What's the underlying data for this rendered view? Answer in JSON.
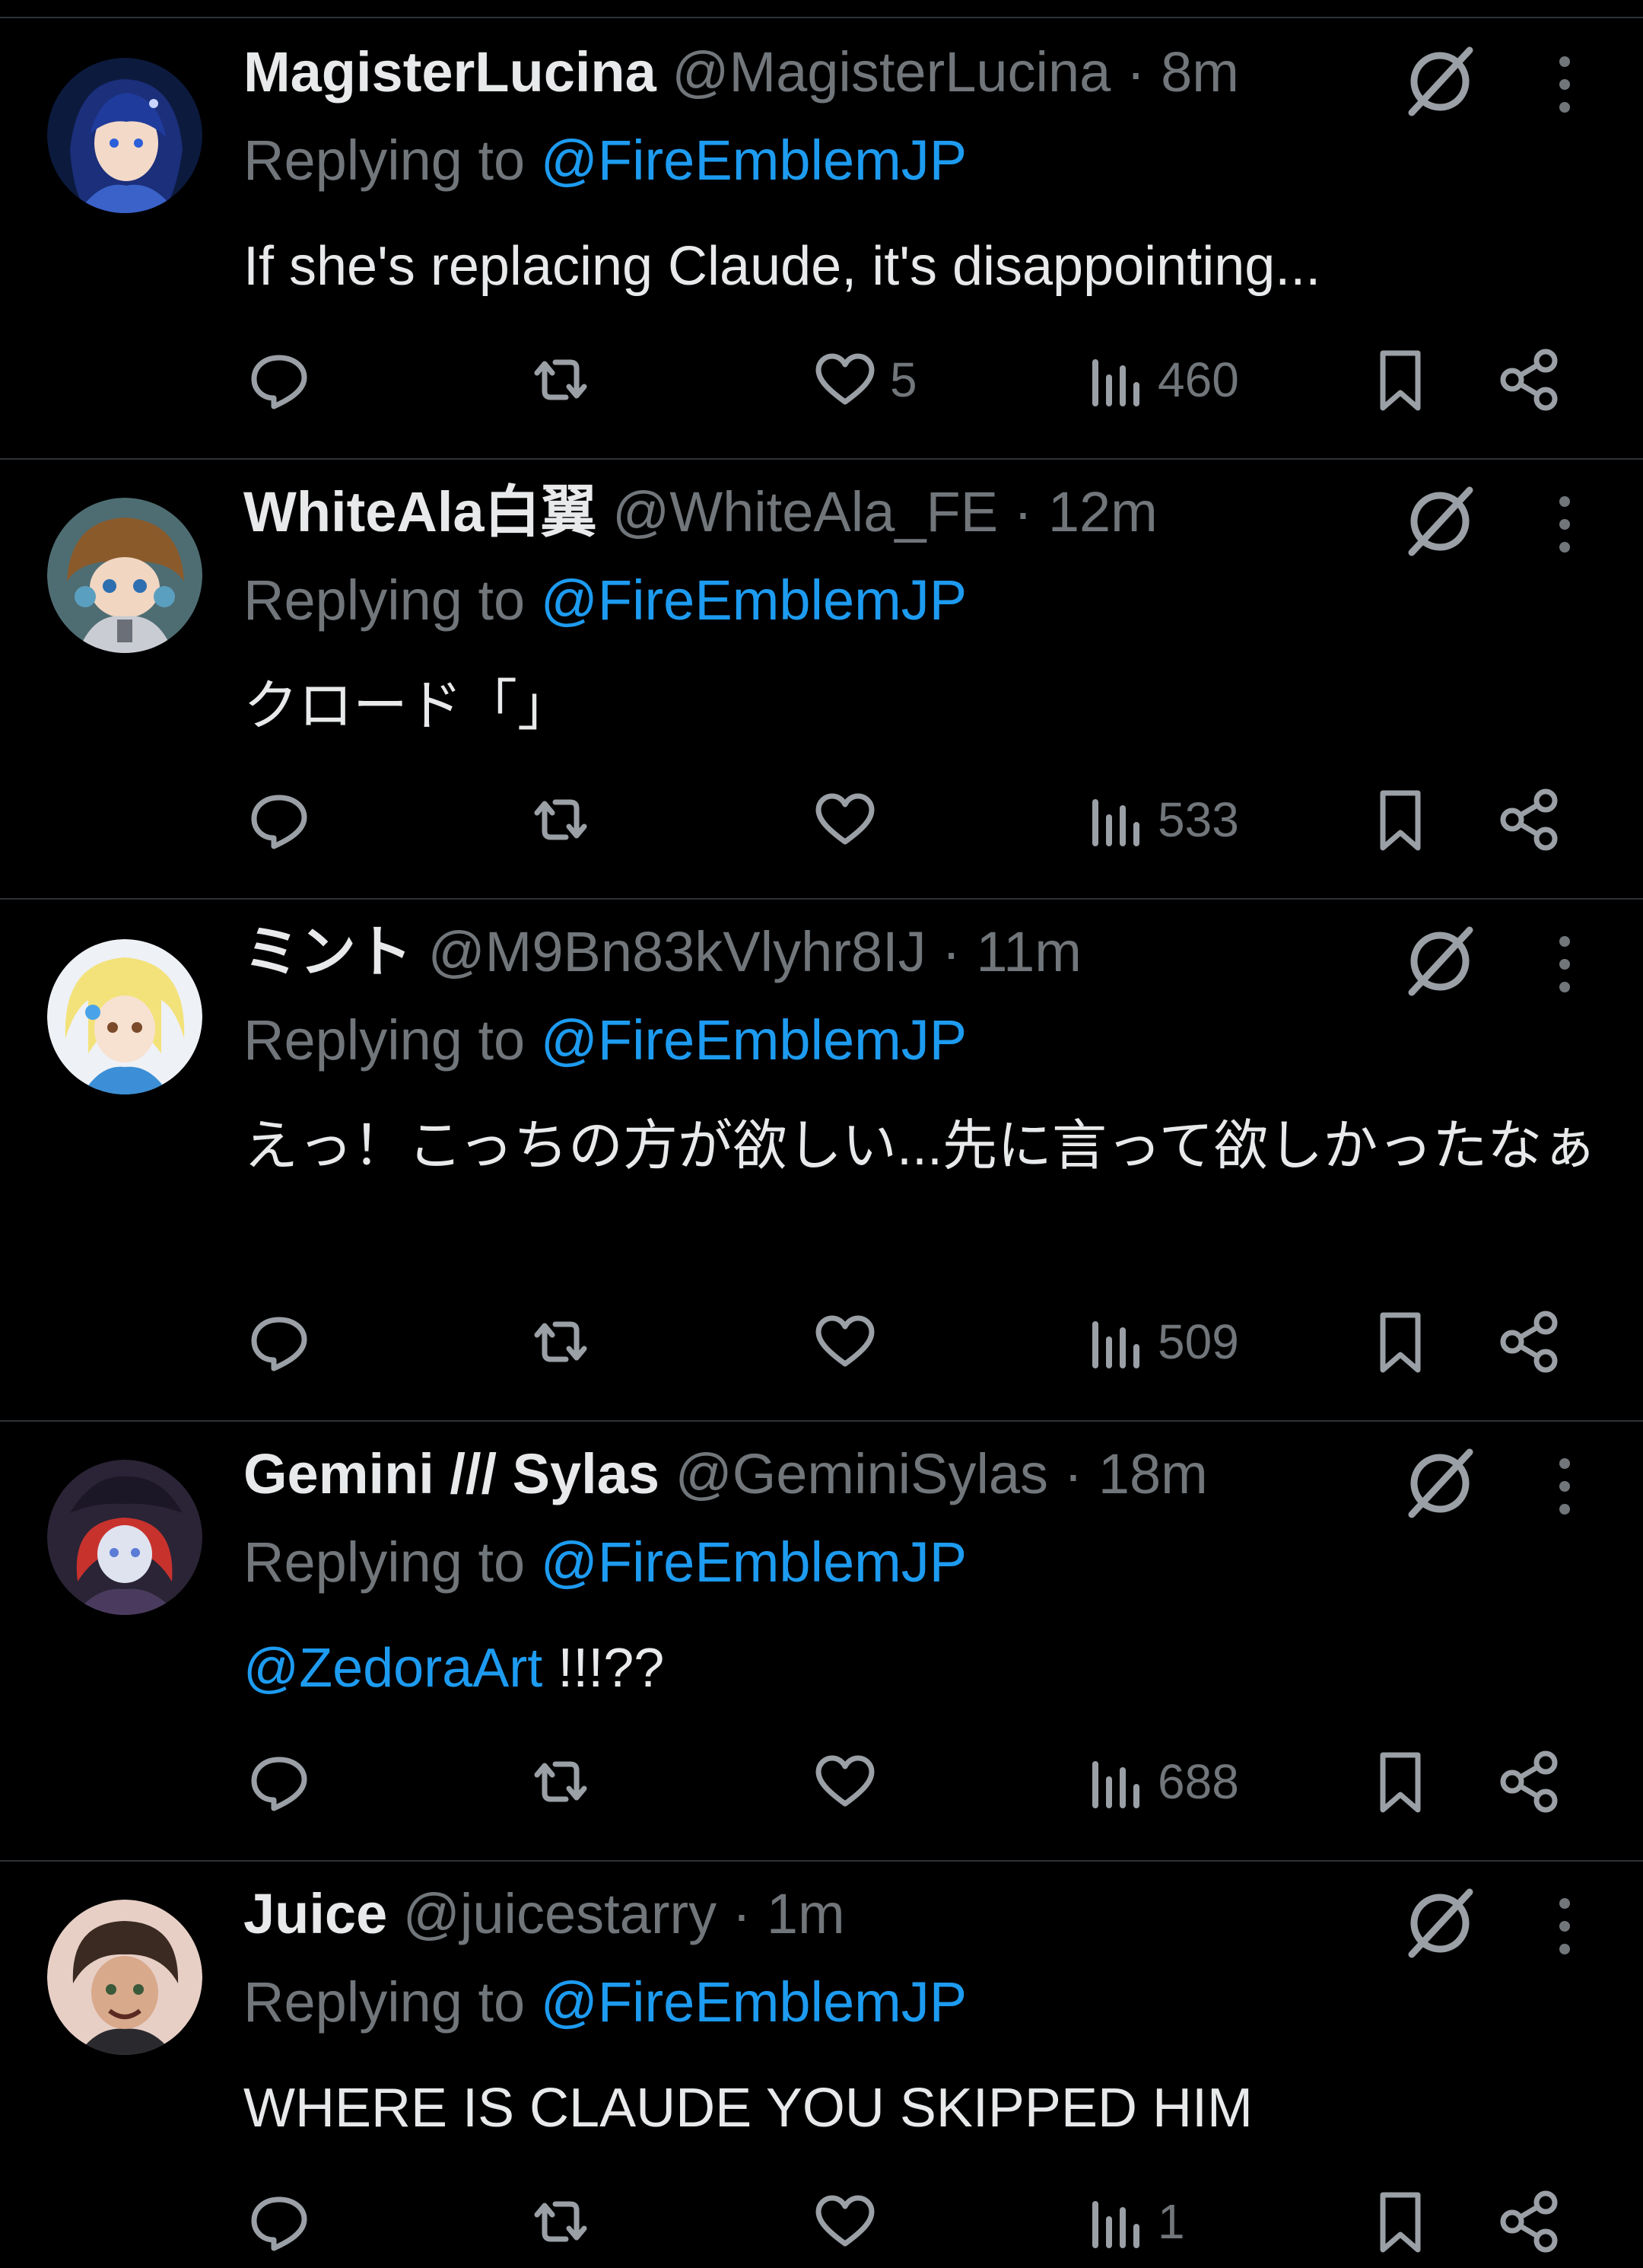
{
  "theme": {
    "background": "#000000",
    "text": "#e7e9ea",
    "muted": "#71767b",
    "link": "#1d9bf0",
    "divider": "#2f3336"
  },
  "tweets": [
    {
      "display_name": "MagisterLucina",
      "handle": "@MagisterLucina",
      "separator": "·",
      "time": "8m",
      "reply_prefix": "Replying to",
      "reply_to": "@FireEmblemJP",
      "text_mention": "",
      "text": "If she's replacing Claude, it's disappointing...",
      "likes": "5",
      "views": "460",
      "avatar_icon": "avatar-blue-haired-character"
    },
    {
      "display_name": "WhiteAla白翼",
      "handle": "@WhiteAla_FE",
      "separator": "·",
      "time": "12m",
      "reply_prefix": "Replying to",
      "reply_to": "@FireEmblemJP",
      "text_mention": "",
      "text": "クロード「」",
      "likes": "",
      "views": "533",
      "avatar_icon": "avatar-brown-haired-character"
    },
    {
      "display_name": "ミント",
      "handle": "@M9Bn83kVlyhr8IJ",
      "separator": "·",
      "time": "11m",
      "reply_prefix": "Replying to",
      "reply_to": "@FireEmblemJP",
      "text_mention": "",
      "text": "えっ！こっちの方が欲しい...先に言って欲しかったなぁ",
      "likes": "",
      "views": "509",
      "avatar_icon": "avatar-blonde-character"
    },
    {
      "display_name": "Gemini /// Sylas",
      "handle": "@GeminiSylas",
      "separator": "·",
      "time": "18m",
      "reply_prefix": "Replying to",
      "reply_to": "@FireEmblemJP",
      "text_mention": "@ZedoraArt",
      "text": " !!!??",
      "likes": "",
      "views": "688",
      "avatar_icon": "avatar-red-haired-character"
    },
    {
      "display_name": "Juice",
      "handle": "@juicestarry",
      "separator": "·",
      "time": "1m",
      "reply_prefix": "Replying to",
      "reply_to": "@FireEmblemJP",
      "text_mention": "",
      "text": "WHERE IS CLAUDE YOU SKIPPED HIM",
      "likes": "",
      "views": "1",
      "avatar_icon": "avatar-dark-haired-character"
    }
  ]
}
